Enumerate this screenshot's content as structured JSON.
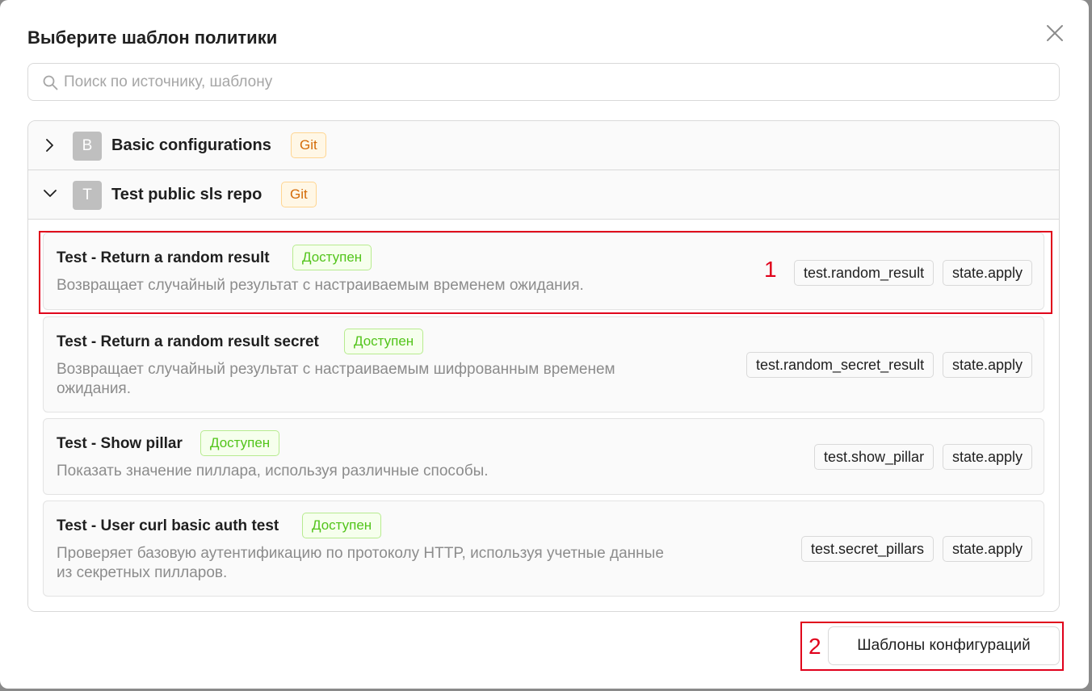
{
  "modal": {
    "title": "Выберите шаблон политики",
    "close_icon": "close-icon"
  },
  "search": {
    "placeholder": "Поиск по источнику, шаблону",
    "value": "",
    "icon": "search-icon"
  },
  "repos": [
    {
      "avatar": "B",
      "name": "Basic configurations",
      "tag": "Git",
      "expanded": false,
      "chevron": "chevron-right-icon"
    },
    {
      "avatar": "T",
      "name": "Test public sls repo",
      "tag": "Git",
      "expanded": true,
      "chevron": "chevron-down-icon"
    }
  ],
  "templates": [
    {
      "title": "Test - Return a random result",
      "status": "Доступен",
      "description": "Возвращает случайный результат с настраиваемым временем ожидания.",
      "tags": [
        "test.random_result",
        "state.apply"
      ]
    },
    {
      "title": "Test - Return a random result secret",
      "status": "Доступен",
      "description": "Возвращает случайный результат с настраиваемым шифрованным временем ожидания.",
      "tags": [
        "test.random_secret_result",
        "state.apply"
      ]
    },
    {
      "title": "Test - Show pillar",
      "status": "Доступен",
      "description": "Показать значение пиллара, используя различные способы.",
      "tags": [
        "test.show_pillar",
        "state.apply"
      ]
    },
    {
      "title": "Test - User curl basic auth test",
      "status": "Доступен",
      "description": "Проверяет базовую аутентификацию по протоколу HTTP, используя учетные данные из секретных пилларов.",
      "tags": [
        "test.secret_pillars",
        "state.apply"
      ]
    }
  ],
  "annotations": {
    "marker_1": "1",
    "marker_2": "2"
  },
  "footer": {
    "config_templates_label": "Шаблоны конфигураций"
  },
  "colors": {
    "highlight": "#e0001b",
    "status_green": "#52c41a",
    "git_orange": "#d46b08"
  }
}
